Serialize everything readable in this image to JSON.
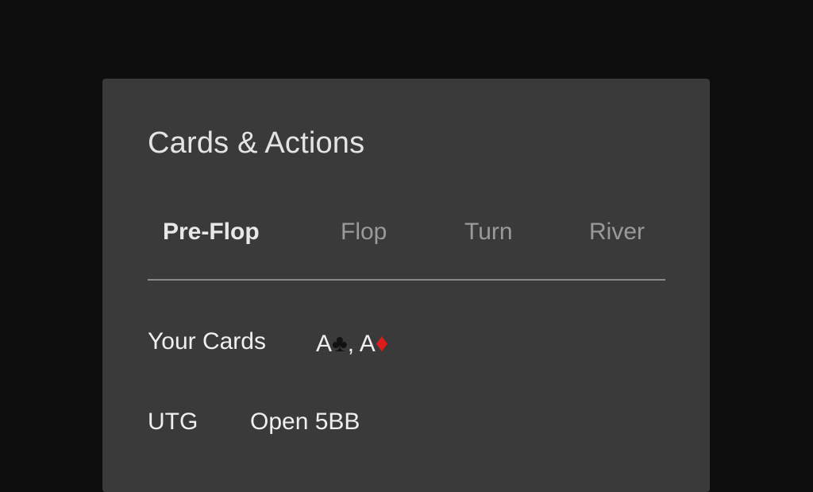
{
  "panel": {
    "title": "Cards & Actions"
  },
  "tabs": [
    {
      "label": "Pre-Flop",
      "active": true
    },
    {
      "label": "Flop",
      "active": false
    },
    {
      "label": "Turn",
      "active": false
    },
    {
      "label": "River",
      "active": false
    }
  ],
  "your_cards": {
    "label": "Your Cards",
    "card1_rank": "A",
    "card1_suit": "♣",
    "separator": ", ",
    "card2_rank": "A",
    "card2_suit": "♦"
  },
  "action_row": {
    "position": "UTG",
    "action": "Open 5BB"
  },
  "colors": {
    "background": "#0e0e0e",
    "panel": "#3a3a3a",
    "active_tab": "#e8e8e8",
    "inactive_tab": "#9a9a9a",
    "diamond": "#e01b1b",
    "club": "#111111"
  }
}
